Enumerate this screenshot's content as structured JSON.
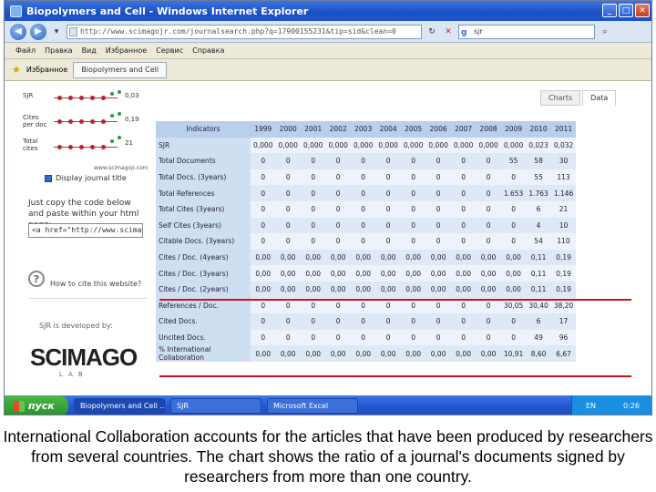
{
  "window": {
    "title": "Biopolymers and Cell - Windows Internet Explorer",
    "min": "_",
    "max": "□",
    "close": "✕"
  },
  "address": {
    "url": "http://www.scimagojr.com/journalsearch.php?q=17900155231&tip=sid&clean=0",
    "search_value": "sjr"
  },
  "menu": [
    "Файл",
    "Правка",
    "Вид",
    "Избранное",
    "Сервис",
    "Справка"
  ],
  "favbar": {
    "favorites_label": "Избранное",
    "tab_label": "Biopolymers and Cell"
  },
  "legend": [
    {
      "label_lines": [
        "SJR"
      ],
      "value": "0,03"
    },
    {
      "label_lines": [
        "Cites",
        "per doc"
      ],
      "value": "0,19"
    },
    {
      "label_lines": [
        "Total",
        "cites"
      ],
      "value": "21"
    }
  ],
  "left": {
    "site": "www.scimagojr.com",
    "display_title": "Display journal title",
    "copy_text": "Just copy the code below and paste within your html page:",
    "code_value": "<a href=\"http://www.scimagojr",
    "how_cite": "How to cite this website?",
    "developed_by": "SJR is developed by:",
    "logo": "SCIMAGO",
    "lab": "LAB"
  },
  "chart_tabs": [
    "Charts",
    "Data"
  ],
  "table": {
    "header": [
      "Indicators",
      "1999",
      "2000",
      "2001",
      "2002",
      "2003",
      "2004",
      "2005",
      "2006",
      "2007",
      "2008",
      "2009",
      "2010",
      "2011"
    ],
    "rows": [
      [
        "SJR",
        "0,000",
        "0,000",
        "0,000",
        "0,000",
        "0,000",
        "0,000",
        "0,000",
        "0,000",
        "0,000",
        "0,000",
        "0,000",
        "0,023",
        "0,032"
      ],
      [
        "Total Documents",
        "0",
        "0",
        "0",
        "0",
        "0",
        "0",
        "0",
        "0",
        "0",
        "0",
        "55",
        "58",
        "30"
      ],
      [
        "Total Docs. (3years)",
        "0",
        "0",
        "0",
        "0",
        "0",
        "0",
        "0",
        "0",
        "0",
        "0",
        "0",
        "55",
        "113"
      ],
      [
        "Total References",
        "0",
        "0",
        "0",
        "0",
        "0",
        "0",
        "0",
        "0",
        "0",
        "0",
        "1.653",
        "1.763",
        "1.146"
      ],
      [
        "Total Cites (3years)",
        "0",
        "0",
        "0",
        "0",
        "0",
        "0",
        "0",
        "0",
        "0",
        "0",
        "0",
        "6",
        "21"
      ],
      [
        "Self Cites (3years)",
        "0",
        "0",
        "0",
        "0",
        "0",
        "0",
        "0",
        "0",
        "0",
        "0",
        "0",
        "4",
        "10"
      ],
      [
        "Citable Docs. (3years)",
        "0",
        "0",
        "0",
        "0",
        "0",
        "0",
        "0",
        "0",
        "0",
        "0",
        "0",
        "54",
        "110"
      ],
      [
        "Cites / Doc. (4years)",
        "0,00",
        "0,00",
        "0,00",
        "0,00",
        "0,00",
        "0,00",
        "0,00",
        "0,00",
        "0,00",
        "0,00",
        "0,00",
        "0,11",
        "0,19"
      ],
      [
        "Cites / Doc. (3years)",
        "0,00",
        "0,00",
        "0,00",
        "0,00",
        "0,00",
        "0,00",
        "0,00",
        "0,00",
        "0,00",
        "0,00",
        "0,00",
        "0,11",
        "0,19"
      ],
      [
        "Cites / Doc. (2years)",
        "0,00",
        "0,00",
        "0,00",
        "0,00",
        "0,00",
        "0,00",
        "0,00",
        "0,00",
        "0,00",
        "0,00",
        "0,00",
        "0,11",
        "0,19"
      ],
      [
        "References / Doc.",
        "0",
        "0",
        "0",
        "0",
        "0",
        "0",
        "0",
        "0",
        "0",
        "0",
        "30,05",
        "30,40",
        "38,20"
      ],
      [
        "Cited Docs.",
        "0",
        "0",
        "0",
        "0",
        "0",
        "0",
        "0",
        "0",
        "0",
        "0",
        "0",
        "6",
        "17"
      ],
      [
        "Uncited Docs.",
        "0",
        "0",
        "0",
        "0",
        "0",
        "0",
        "0",
        "0",
        "0",
        "0",
        "0",
        "49",
        "96"
      ],
      [
        "% International Collaboration",
        "0,00",
        "0,00",
        "0,00",
        "0,00",
        "0,00",
        "0,00",
        "0,00",
        "0,00",
        "0,00",
        "0,00",
        "10,91",
        "8,60",
        "6,67"
      ]
    ]
  },
  "taskbar": {
    "start": "пуск",
    "buttons": [
      "Biopolymers and Cell ...",
      "SJR",
      "Microsoft Excel"
    ],
    "lang": "EN",
    "clock": "0:26"
  },
  "caption": "International Collaboration accounts for the articles that have been produced by researchers from several countries. The chart shows the ratio of a journal's documents signed by researchers from more than one country.",
  "colors": {
    "highlight_line": "#cc1020",
    "table_header": "#b8d0ec",
    "taskbar": "#2458d0"
  }
}
